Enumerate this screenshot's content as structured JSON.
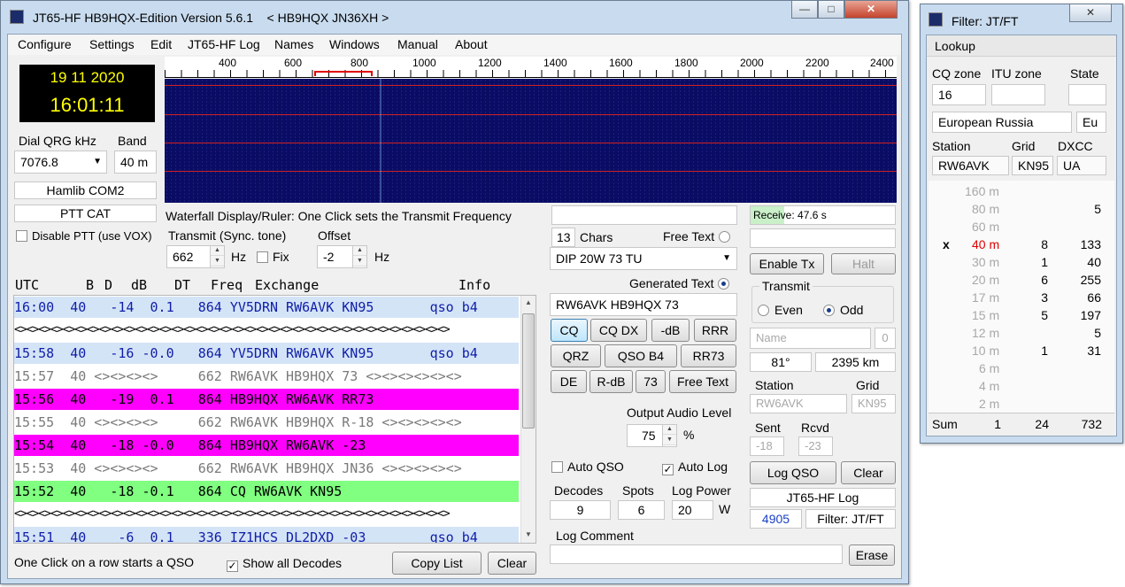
{
  "main_window": {
    "title": "JT65-HF HB9HQX-Edition Version 5.6.1    < HB9HQX JN36XH >",
    "menu": [
      "Configure",
      "Settings",
      "Edit",
      "JT65-HF Log",
      "Names",
      "Windows",
      "Manual",
      "About"
    ],
    "date": "19 11 2020",
    "time": "16:01:11",
    "dial_qrg_label": "Dial QRG kHz",
    "dial_qrg_value": "7076.8",
    "band_label": "Band",
    "band_value": "40 m",
    "rig_interface": "Hamlib COM2",
    "ptt_mode": "PTT CAT",
    "disable_ptt_label": "Disable PTT (use VOX)",
    "ruler_ticks": [
      "400",
      "600",
      "800",
      "1000",
      "1200",
      "1400",
      "1600",
      "1800",
      "2000",
      "2200",
      "2400"
    ],
    "waterfall_caption": "Waterfall Display/Ruler: One Click sets the Transmit Frequency",
    "transmit_label": "Transmit (Sync. tone)",
    "transmit_value": "662",
    "hz": "Hz",
    "fix_label": "Fix",
    "offset_label": "Offset",
    "offset_value": "-2",
    "decode_headers": {
      "utc": "UTC",
      "b": "B",
      "d": "D",
      "db": "dB",
      "dt": "DT",
      "freq": "Freq",
      "exchange": "Exchange",
      "info": "Info"
    },
    "decodes": [
      {
        "style": "blue",
        "text": "16:00  40   -14  0.1   864 YV5DRN RW6AVK KN95       qso b4"
      },
      {
        "style": "sep",
        "text": "<><><><><><><><><><><><><><><><><><><><><><><><><><><><><><><><><><><><>"
      },
      {
        "style": "blue",
        "text": "15:58  40   -16 -0.0   864 YV5DRN RW6AVK KN95       qso b4"
      },
      {
        "style": "gray",
        "text": "15:57  40 <><><><>     662 RW6AVK HB9HQX 73 <><><><><><>"
      },
      {
        "style": "mag",
        "text": "15:56  40   -19  0.1   864 HB9HQX RW6AVK RR73"
      },
      {
        "style": "gray",
        "text": "15:55  40 <><><><>     662 RW6AVK HB9HQX R-18 <><><><><>"
      },
      {
        "style": "mag",
        "text": "15:54  40   -18 -0.0   864 HB9HQX RW6AVK -23"
      },
      {
        "style": "gray",
        "text": "15:53  40 <><><><>     662 RW6AVK HB9HQX JN36 <><><><><>"
      },
      {
        "style": "green",
        "text": "15:52  40   -18 -0.1   864 CQ RW6AVK KN95"
      },
      {
        "style": "sep",
        "text": "<><><><><><><><><><><><><><><><><><><><><><><><><><><><><><><><><><><><>"
      },
      {
        "style": "blue",
        "text": "15:51  40    -6  0.1   336 IZ1HCS DL2DXD -03        qso b4"
      }
    ],
    "footer_hint": "One Click on a row starts a QSO",
    "show_all_label": "Show all Decodes",
    "copy_list": "Copy List",
    "clear_list": "Clear",
    "chars_count": "13",
    "chars_label": "Chars",
    "free_text_label": "Free Text",
    "free_text_value": "DIP 20W 73 TU",
    "generated_text_label": "Generated Text",
    "generated_text_value": "RW6AVK HB9HQX 73",
    "macro_buttons": [
      [
        "CQ",
        "CQ DX",
        "-dB",
        "RRR"
      ],
      [
        "QRZ",
        "QSO B4",
        "RR73"
      ],
      [
        "DE",
        "R-dB",
        "73",
        "Free Text"
      ]
    ],
    "output_audio_label": "Output Audio Level",
    "output_audio_value": "75",
    "percent": "%",
    "auto_qso_label": "Auto QSO",
    "auto_log_label": "Auto Log",
    "decodes_label": "Decodes",
    "decodes_value": "9",
    "spots_label": "Spots",
    "spots_value": "6",
    "log_power_label": "Log Power",
    "log_power_value": "20",
    "watt": "W",
    "log_comment_label": "Log Comment",
    "erase_label": "Erase",
    "receive_text": "Receive: 47.6 s",
    "enable_tx": "Enable Tx",
    "halt": "Halt",
    "transmit_group": "Transmit",
    "even_label": "Even",
    "odd_label": "Odd",
    "name_placeholder": "Name",
    "name_count": "0",
    "bearing": "81°",
    "distance": "2395 km",
    "station_label": "Station",
    "grid_label": "Grid",
    "station_value": "RW6AVK",
    "grid_value": "KN95",
    "sent_label": "Sent",
    "rcvd_label": "Rcvd",
    "sent_value": "-18",
    "rcvd_value": "-23",
    "log_qso": "Log QSO",
    "clear_qso": "Clear",
    "log_title": "JT65-HF Log",
    "log_count": "4905",
    "log_filter": "Filter: JT/FT"
  },
  "filter_window": {
    "title": "Filter: JT/FT",
    "lookup_label": "Lookup",
    "cq_zone_label": "CQ zone",
    "itu_zone_label": "ITU zone",
    "state_label": "State",
    "cq_zone_value": "16",
    "country": "European Russia",
    "continent": "Eu",
    "station_label": "Station",
    "grid_label": "Grid",
    "dxcc_label": "DXCC",
    "station_value": "RW6AVK",
    "grid_value": "KN95",
    "dxcc_value": "UA",
    "bands": [
      {
        "band": "160 m",
        "mark": "",
        "a": "",
        "b": ""
      },
      {
        "band": "80 m",
        "mark": "",
        "a": "",
        "b": "5"
      },
      {
        "band": "60 m",
        "mark": "",
        "a": "",
        "b": ""
      },
      {
        "band": "40 m",
        "mark": "x",
        "a": "8",
        "b": "133",
        "active": true
      },
      {
        "band": "30 m",
        "mark": "",
        "a": "1",
        "b": "40"
      },
      {
        "band": "20 m",
        "mark": "",
        "a": "6",
        "b": "255"
      },
      {
        "band": "17 m",
        "mark": "",
        "a": "3",
        "b": "66"
      },
      {
        "band": "15 m",
        "mark": "",
        "a": "5",
        "b": "197"
      },
      {
        "band": "12 m",
        "mark": "",
        "a": "",
        "b": "5"
      },
      {
        "band": "10 m",
        "mark": "",
        "a": "1",
        "b": "31"
      },
      {
        "band": "6 m",
        "mark": "",
        "a": "",
        "b": ""
      },
      {
        "band": "4 m",
        "mark": "",
        "a": "",
        "b": ""
      },
      {
        "band": "2 m",
        "mark": "",
        "a": "",
        "b": ""
      }
    ],
    "sum_label": "Sum",
    "sum_values": [
      "1",
      "24",
      "732"
    ]
  }
}
